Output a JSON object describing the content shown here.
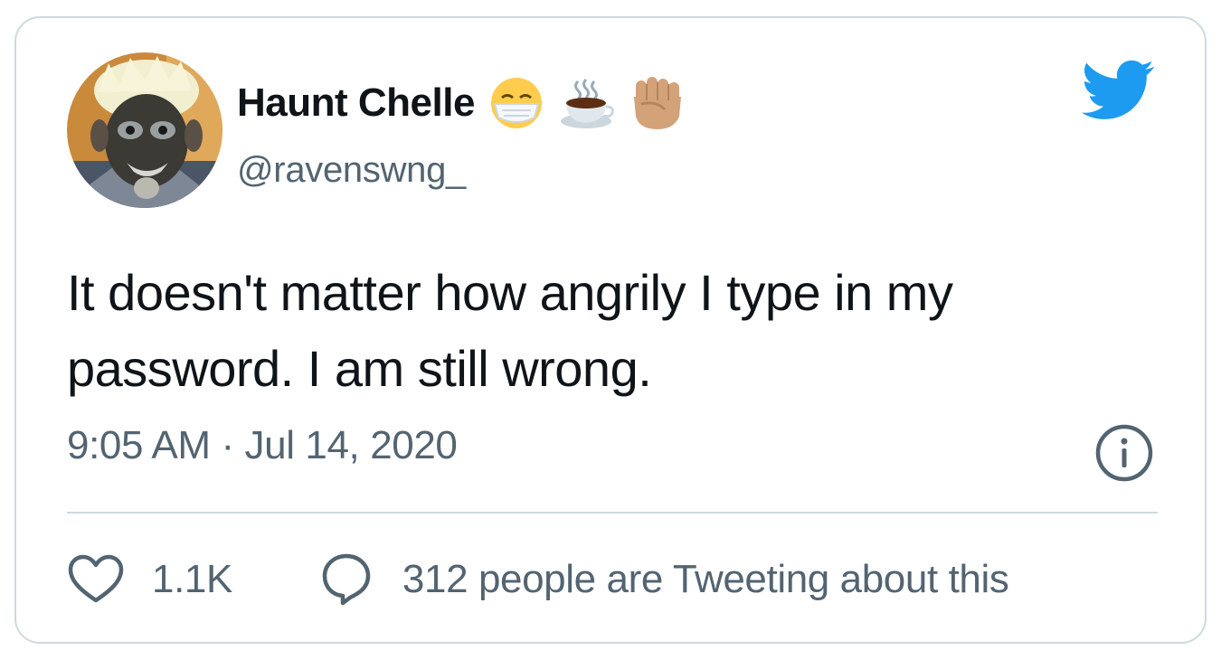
{
  "tweet": {
    "author": {
      "display_name": "Haunt Chelle",
      "handle": "@ravenswng_",
      "name_emojis": [
        "face-with-medical-mask",
        "hot-beverage",
        "raised-fist"
      ]
    },
    "brand_icon": "twitter-bird-icon",
    "text": "It doesn't matter how angrily I type in my password. I am still wrong.",
    "timestamp": "9:05 AM · Jul 14, 2020",
    "actions": {
      "likes_count": "1.1K",
      "replies_label": "312 people are Tweeting about this"
    }
  },
  "colors": {
    "brand": "#1d9bf0",
    "text_primary": "#0f1419",
    "text_secondary": "#536471",
    "border": "#cfd9de"
  }
}
